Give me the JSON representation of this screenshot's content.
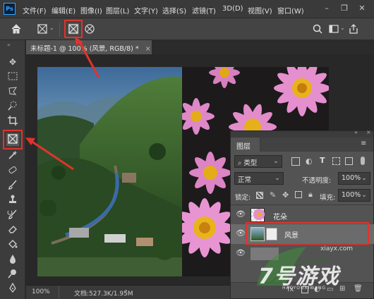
{
  "app": {
    "logo": "Ps"
  },
  "menu": [
    "文件(F)",
    "编辑(E)",
    "图像(I)",
    "图层(L)",
    "文字(Y)",
    "选择(S)",
    "滤镜(T)",
    "3D(D)",
    "视图(V)",
    "窗口(W)"
  ],
  "document": {
    "tab_title": "未标题-1 @ 100% (风景, RGB/8) *",
    "close": "×"
  },
  "status": {
    "zoom": "100%",
    "doc_info": "文档:527.3K/1.95M",
    "arrow": "›"
  },
  "layers_panel": {
    "title": "图层",
    "kind_filter": "类型",
    "blend_mode": "正常",
    "opacity_label": "不透明度:",
    "opacity_value": "100%",
    "lock_label": "锁定:",
    "fill_label": "填充:",
    "fill_value": "100%",
    "layers": [
      {
        "name": "花朵"
      },
      {
        "name": "风景"
      }
    ]
  },
  "watermark": {
    "text": "7号游戏",
    "subtext": "HAOYOUXIWANG",
    "site": "xiayx.com"
  },
  "colors": {
    "accent_red": "#e0332d",
    "ps_blue": "#31a8ff",
    "selected_layer": "#6b6b6b"
  }
}
